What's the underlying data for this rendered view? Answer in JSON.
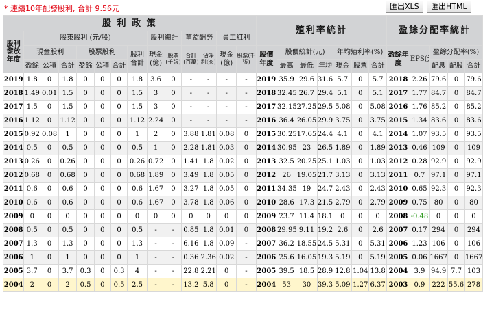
{
  "toolbar": {
    "note": "* 連續10年配發股利, 合計 9.56元",
    "export_xls": "匯出XLS",
    "export_html": "匯出HTML"
  },
  "header": {
    "dividend_policy": "股 利 政 策",
    "yield_stats": "殖利率統計",
    "payout_stats": "盈餘分配率統計",
    "dividend_year": "股利發放年度",
    "share_dividend_group": "股東股利 (元/股)",
    "dividend_total": "股利總計",
    "board_compensation": "董監酬勞",
    "employee_bonus": "員工紅利",
    "cash_dividend": "現金股利",
    "stock_dividend": "股票股利",
    "earnings": "盈餘",
    "reserve": "公積",
    "sum": "合計",
    "dividend_sum": "股利合計",
    "cash_100m": "現金(億)",
    "stock_thousand": "股票(千張)",
    "total_million": "合計(百萬)",
    "pct_of_net": "佔淨利(%)",
    "stock_year": "股價年度",
    "price_stats": "股價統計(元)",
    "avg_yield": "年均殖利率(%)",
    "high": "最高",
    "low": "最低",
    "avg": "年均",
    "cash": "現金",
    "stock": "股票",
    "payout_year": "盈餘年度",
    "eps": "EPS(元)",
    "payout_ratio": "盈餘分配率(%)",
    "alloc_earn": "配息",
    "alloc_stock": "配股"
  },
  "rows": [
    [
      "2019",
      "1.8",
      "0",
      "1.8",
      "0",
      "0",
      "0",
      "1.8",
      "3.6",
      "0",
      "-",
      "-",
      "-",
      "-",
      "2019",
      "35.9",
      "29.6",
      "31.6",
      "5.7",
      "0",
      "5.7",
      "2018",
      "2.26",
      "79.6",
      "0",
      "79.6"
    ],
    [
      "2018",
      "1.49",
      "0.01",
      "1.5",
      "0",
      "0",
      "0",
      "1.5",
      "3",
      "0",
      "-",
      "-",
      "-",
      "-",
      "2018",
      "32.45",
      "26.7",
      "29.4",
      "5.1",
      "0",
      "5.1",
      "2017",
      "1.77",
      "84.7",
      "0",
      "84.7"
    ],
    [
      "2017",
      "1.5",
      "0",
      "1.5",
      "0",
      "0",
      "0",
      "1.5",
      "3",
      "0",
      "-",
      "-",
      "-",
      "-",
      "2017",
      "32.15",
      "27.25",
      "29.5",
      "5.08",
      "0",
      "5.08",
      "2016",
      "1.76",
      "85.2",
      "0",
      "85.2"
    ],
    [
      "2016",
      "1.12",
      "0",
      "1.12",
      "0",
      "0",
      "0",
      "1.12",
      "2.24",
      "0",
      "-",
      "-",
      "-",
      "-",
      "2016",
      "36.4",
      "26.05",
      "29.9",
      "3.75",
      "0",
      "3.75",
      "2015",
      "1.34",
      "83.6",
      "0",
      "83.6"
    ],
    [
      "2015",
      "0.92",
      "0.08",
      "1",
      "0",
      "0",
      "0",
      "1",
      "2",
      "0",
      "3.88",
      "1.81",
      "0.08",
      "0",
      "2015",
      "30.25",
      "17.65",
      "24.4",
      "4.1",
      "0",
      "4.1",
      "2014",
      "1.07",
      "93.5",
      "0",
      "93.5"
    ],
    [
      "2014",
      "0.5",
      "0",
      "0.5",
      "0",
      "0",
      "0",
      "0.5",
      "1",
      "0",
      "2.28",
      "1.81",
      "0.03",
      "0",
      "2014",
      "30.95",
      "23",
      "26.5",
      "1.89",
      "0",
      "1.89",
      "2013",
      "0.46",
      "109",
      "0",
      "109"
    ],
    [
      "2013",
      "0.26",
      "0",
      "0.26",
      "0",
      "0",
      "0",
      "0.26",
      "0.72",
      "0",
      "1.41",
      "1.8",
      "0.02",
      "0",
      "2013",
      "32.5",
      "20.25",
      "25.1",
      "1.03",
      "0",
      "1.03",
      "2012",
      "0.28",
      "92.9",
      "0",
      "92.9"
    ],
    [
      "2012",
      "0.68",
      "0",
      "0.68",
      "0",
      "0",
      "0",
      "0.68",
      "1.89",
      "0",
      "3.49",
      "1.8",
      "0.05",
      "0",
      "2012",
      "26",
      "19.05",
      "21.7",
      "3.13",
      "0",
      "3.13",
      "2011",
      "0.7",
      "97.1",
      "0",
      "97.1"
    ],
    [
      "2011",
      "0.6",
      "0",
      "0.6",
      "0",
      "0",
      "0",
      "0.6",
      "1.67",
      "0",
      "3.27",
      "1.8",
      "0.05",
      "0",
      "2011",
      "34.35",
      "19",
      "24.7",
      "2.43",
      "0",
      "2.43",
      "2010",
      "0.65",
      "92.3",
      "0",
      "92.3"
    ],
    [
      "2010",
      "0.6",
      "0",
      "0.6",
      "0",
      "0",
      "0",
      "0.6",
      "1.67",
      "0",
      "3.78",
      "1.8",
      "0.06",
      "0",
      "2010",
      "28.6",
      "17.3",
      "21.5",
      "2.79",
      "0",
      "2.79",
      "2009",
      "0.75",
      "80",
      "0",
      "80"
    ],
    [
      "2009",
      "0",
      "0",
      "0",
      "0",
      "0",
      "0",
      "0",
      "0",
      "0",
      "0",
      "0",
      "0",
      "0",
      "2009",
      "23.7",
      "11.4",
      "18.1",
      "0",
      "0",
      "0",
      "2008",
      "-0.48",
      "0",
      "0",
      "0"
    ],
    [
      "2008",
      "0.5",
      "0",
      "0.5",
      "0",
      "0",
      "0",
      "0.5",
      "-",
      "-",
      "0.85",
      "1.8",
      "0.01",
      "0",
      "2008",
      "29.95",
      "9.11",
      "19.2",
      "2.6",
      "0",
      "2.6",
      "2007",
      "0.17",
      "294",
      "0",
      "294"
    ],
    [
      "2007",
      "1.3",
      "0",
      "1.3",
      "0",
      "0",
      "0",
      "1.3",
      "-",
      "-",
      "6.16",
      "1.8",
      "0.09",
      "-",
      "2007",
      "36.2",
      "18.55",
      "24.5",
      "5.31",
      "0",
      "5.31",
      "2006",
      "1.23",
      "106",
      "0",
      "106"
    ],
    [
      "2006",
      "1",
      "0",
      "1",
      "0",
      "0",
      "0",
      "1",
      "-",
      "-",
      "0.36",
      "2.36",
      "0.02",
      "-",
      "2006",
      "25.6",
      "16.05",
      "19.3",
      "5.19",
      "0",
      "5.19",
      "2005",
      "0.06",
      "1667",
      "0",
      "1667"
    ],
    [
      "2005",
      "3.7",
      "0",
      "3.7",
      "0.3",
      "0",
      "0.3",
      "4",
      "-",
      "-",
      "22.8",
      "2.21",
      "0",
      "-",
      "2005",
      "39.5",
      "18.5",
      "28.9",
      "12.8",
      "1.04",
      "13.8",
      "2004",
      "3.9",
      "94.9",
      "7.7",
      "103"
    ],
    [
      "2004",
      "2",
      "0",
      "2",
      "0.5",
      "0",
      "0.5",
      "2.5",
      "-",
      "-",
      "13.2",
      "5.8",
      "0",
      "-",
      "2004",
      "53",
      "30",
      "39.3",
      "5.09",
      "1.27",
      "6.37",
      "2003",
      "0.9",
      "222",
      "55.6",
      "278"
    ]
  ],
  "colors": {
    "header_bg": "#d2d3d5",
    "row_alt_bg": "#f1f1f1",
    "highlight_row_bg": "#fff6cc",
    "note_color": "#e0000f",
    "negative_color": "#2e9a1e"
  }
}
